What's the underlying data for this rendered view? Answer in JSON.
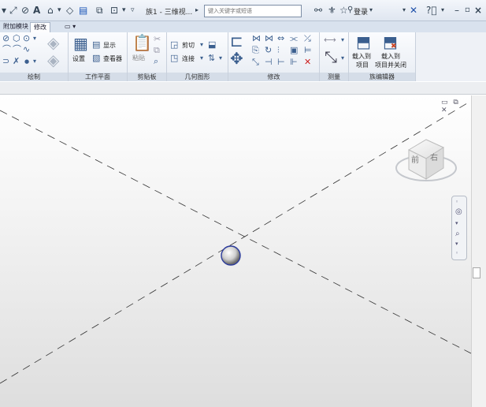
{
  "quick_access": {
    "doc_title": "族1 - 三维视...",
    "search_placeholder": "键入关键字或短语",
    "login_label": "登录",
    "icons": [
      "save-icon",
      "measure-icon",
      "annotate-icon",
      "text-icon",
      "3d-view-icon",
      "section-icon",
      "thin-lines-icon",
      "close-windows-icon",
      "switch-windows-icon",
      "binoculars-icon",
      "subscription-icon",
      "favorites-icon",
      "user-icon",
      "exchange-apps-icon",
      "help-icon"
    ]
  },
  "window_controls": {
    "minimize": "–",
    "restore": "▫",
    "close": "×"
  },
  "tabs": [
    {
      "label": "附加模块"
    },
    {
      "label": "修改"
    },
    {
      "label": "▭ ▾"
    }
  ],
  "ribbon": {
    "panels": [
      {
        "label": "绘制"
      },
      {
        "label": "工作平面"
      },
      {
        "label": "剪贴板"
      },
      {
        "label": "几何图形"
      },
      {
        "label": "修改"
      },
      {
        "label": "测量"
      },
      {
        "label": "族编辑器"
      }
    ],
    "work_plane": {
      "set": "设置",
      "show": "显示",
      "viewer": "查看器"
    },
    "clipboard": {
      "paste": "粘贴"
    },
    "geometry": {
      "cut": "剪切",
      "join": "连接"
    },
    "family_editor": {
      "load_into_project": "载入到\n项目",
      "load_into_project_l1": "载入到",
      "load_into_project_l2": "项目",
      "load_close_l1": "载入到",
      "load_close_l2": "项目并关闭"
    }
  },
  "viewcube": {
    "front": "前",
    "right": "右"
  },
  "view_controls": "▭ ⧉ ✕"
}
